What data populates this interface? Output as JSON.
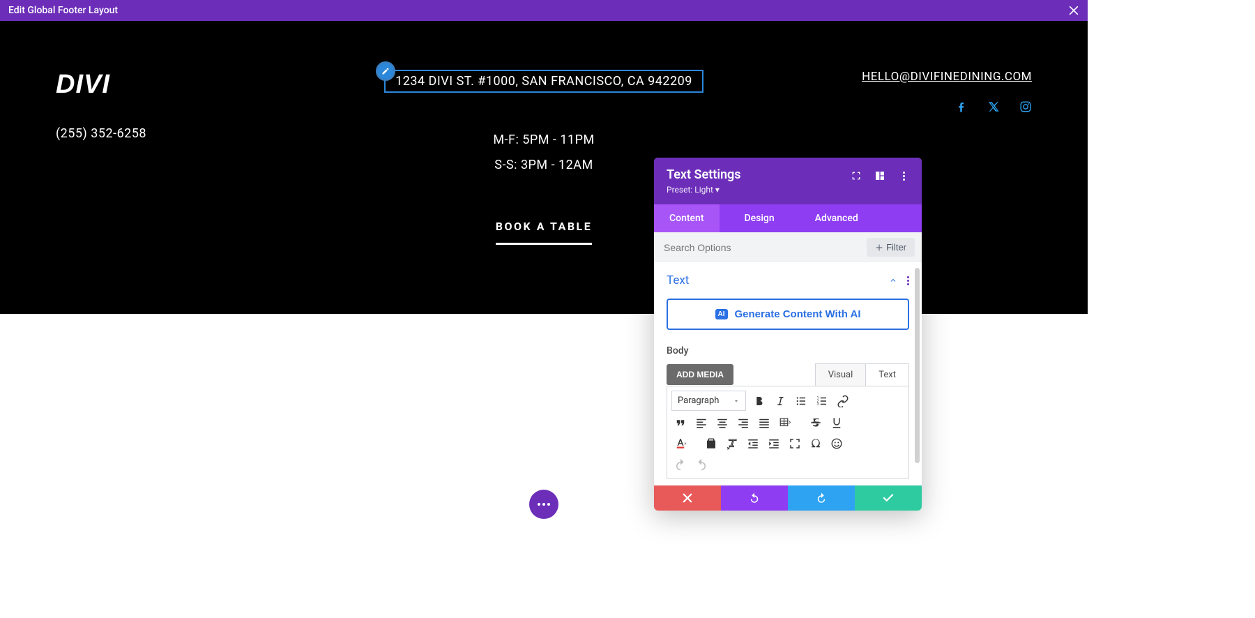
{
  "topbar": {
    "title": "Edit Global Footer Layout"
  },
  "footer": {
    "logo": "DIVI",
    "phone": "(255) 352-6258",
    "address": "1234 DIVI ST. #1000, SAN FRANCISCO, CA 942209",
    "hours_weekday": "M-F: 5PM - 11PM",
    "hours_weekend": "S-S: 3PM - 12AM",
    "cta": "BOOK A TABLE",
    "email": "HELLO@DIVIFINEDINING.COM"
  },
  "panel": {
    "title": "Text Settings",
    "preset": "Preset: Light ▾",
    "tabs": {
      "content": "Content",
      "design": "Design",
      "advanced": "Advanced"
    },
    "search_placeholder": "Search Options",
    "filter_label": "Filter",
    "section": "Text",
    "gen_ai": "Generate Content With AI",
    "body_label": "Body",
    "add_media": "ADD MEDIA",
    "subtabs": {
      "visual": "Visual",
      "text": "Text"
    },
    "format_select": "Paragraph"
  },
  "colors": {
    "brand_purple": "#6c2eb9",
    "tab_purple": "#8e3df2",
    "active_tab": "#a855f7",
    "divi_blue": "#2b87da",
    "link_blue": "#2b70e4",
    "social_blue": "#2ea3f2",
    "danger": "#e85a5a",
    "success": "#2fcba0"
  }
}
